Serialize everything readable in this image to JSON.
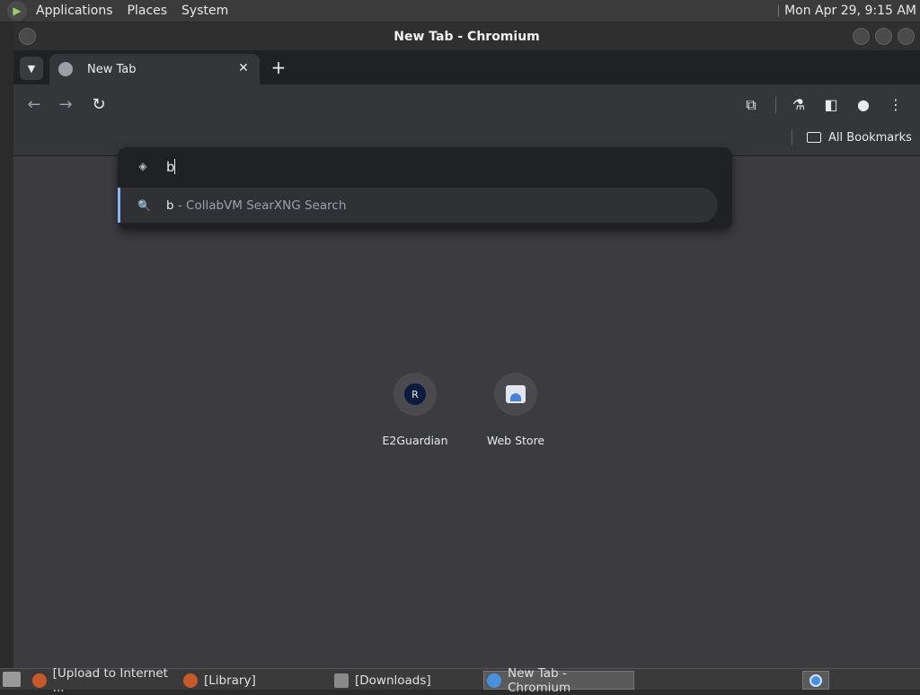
{
  "top_panel": {
    "menus": [
      "Applications",
      "Places",
      "System"
    ],
    "clock": "Mon Apr 29,  9:15 AM"
  },
  "window": {
    "title": "New Tab - Chromium"
  },
  "browser": {
    "tab_title": "New Tab",
    "omnibox": {
      "value": "b",
      "suggestion_query": "b",
      "suggestion_desc": " - CollabVM SearXNG Search"
    },
    "bookmarks_button": "All Bookmarks",
    "shortcuts": [
      {
        "letter": "R",
        "title": "E2Guardian"
      },
      {
        "title": "Web Store"
      }
    ]
  },
  "taskbar": {
    "tasks": [
      "[Upload to Internet ...",
      "[Library]",
      "[Downloads]",
      "New Tab - Chromium"
    ]
  },
  "colors": {
    "accent": "#8ab4f8",
    "panel": "#3b3b3b",
    "content_bg": "#3c3c40"
  }
}
